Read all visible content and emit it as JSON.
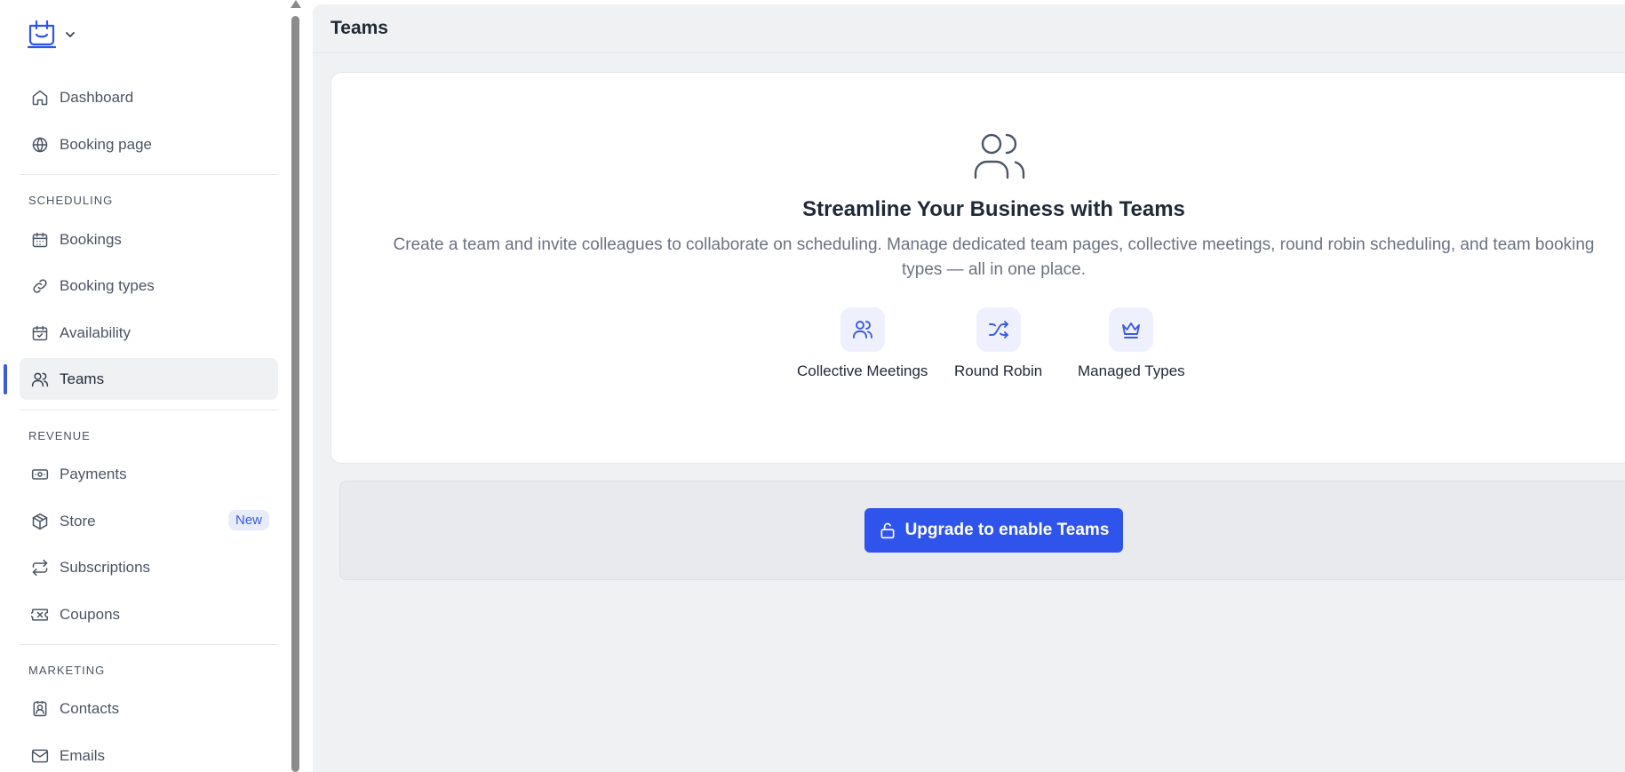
{
  "sidebar": {
    "groups": [
      {
        "items": [
          {
            "label": "Dashboard",
            "icon": "home-icon"
          },
          {
            "label": "Booking page",
            "icon": "globe-icon"
          }
        ]
      },
      {
        "title": "SCHEDULING",
        "items": [
          {
            "label": "Bookings",
            "icon": "calendar-icon"
          },
          {
            "label": "Booking types",
            "icon": "link-icon"
          },
          {
            "label": "Availability",
            "icon": "calendar-check-icon"
          },
          {
            "label": "Teams",
            "icon": "users-icon",
            "active": true
          }
        ]
      },
      {
        "title": "REVENUE",
        "items": [
          {
            "label": "Payments",
            "icon": "banknote-icon"
          },
          {
            "label": "Store",
            "icon": "package-icon",
            "badge": "New"
          },
          {
            "label": "Subscriptions",
            "icon": "repeat-icon"
          },
          {
            "label": "Coupons",
            "icon": "ticket-icon"
          }
        ]
      },
      {
        "title": "MARKETING",
        "items": [
          {
            "label": "Contacts",
            "icon": "contact-icon"
          },
          {
            "label": "Emails",
            "icon": "mail-icon"
          }
        ]
      }
    ]
  },
  "main": {
    "title": "Teams",
    "hero": {
      "icon": "users-icon",
      "title": "Streamline Your Business with Teams",
      "description": "Create a team and invite colleagues to collaborate on scheduling. Manage dedicated team pages, collective meetings, round robin scheduling, and team booking types — all in one place."
    },
    "features": [
      {
        "label": "Collective Meetings",
        "icon": "users-icon"
      },
      {
        "label": "Round Robin",
        "icon": "shuffle-icon"
      },
      {
        "label": "Managed Types",
        "icon": "crown-icon"
      }
    ],
    "upgrade": {
      "label": "Upgrade to enable Teams",
      "icon": "lock-open-icon"
    }
  },
  "colors": {
    "accent": "#2f54eb",
    "active_indicator": "#3b5bdb",
    "main_background": "#f0f1f3"
  }
}
